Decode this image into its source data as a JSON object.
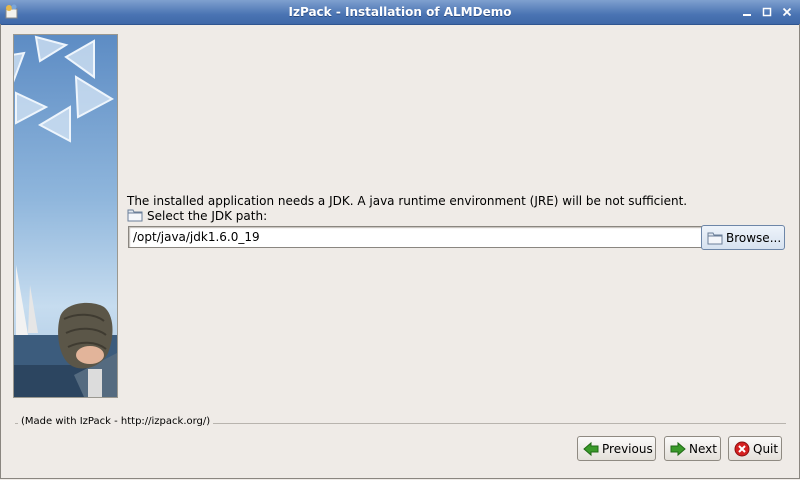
{
  "window": {
    "title": "IzPack - Installation of  ALMDemo",
    "icon": "izpack-app-icon",
    "controls": [
      "minimize-icon",
      "maximize-icon",
      "close-icon"
    ]
  },
  "panel": {
    "message": "The installed application needs a JDK. A java runtime environment (JRE) will be not sufficient.",
    "jdk_label": "Select the JDK path:",
    "jdk_path_value": "/opt/java/jdk1.6.0_19",
    "browse_label": "Browse..."
  },
  "footer": {
    "made_with": "(Made with IzPack - http://izpack.org/)",
    "previous_label": "Previous",
    "next_label": "Next",
    "quit_label": "Quit"
  },
  "colors": {
    "titlebar": "#4a74b3",
    "background": "#efebe7",
    "next_arrow": "#3a9a2a",
    "quit_icon": "#d42020"
  }
}
